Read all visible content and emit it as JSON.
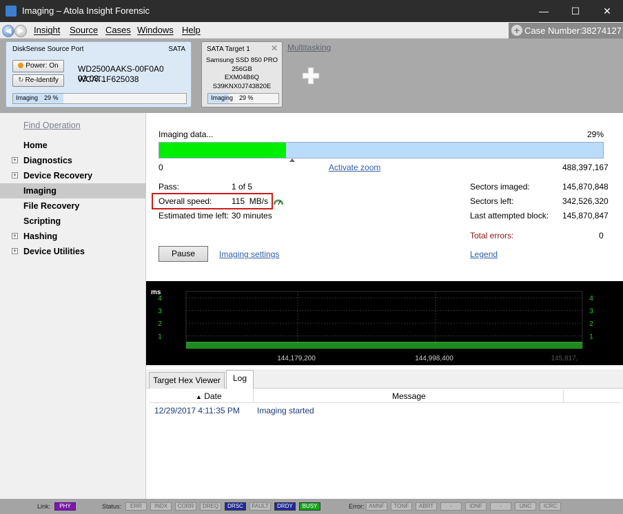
{
  "window": {
    "title": "Imaging – Atola Insight Forensic"
  },
  "menu": [
    "Insight",
    "Source",
    "Cases",
    "Windows",
    "Help"
  ],
  "case": {
    "label": "Case Number:",
    "number": "38274127"
  },
  "source_card": {
    "title": "DiskSense Source Port",
    "iface": "SATA",
    "power_label": "Power: On",
    "reidentify_label": "Re-Identify",
    "model": "WD2500AAKS-00F0A0 03.03...",
    "serial": "WCAT1F625038",
    "status": "Imaging",
    "percent": "29 %",
    "progress": 0.29
  },
  "target_card": {
    "title": "SATA Target 1",
    "line1": "Samsung SSD 850 PRO",
    "line2": "256GB",
    "line3": "EXM04B6Q",
    "line4": "S39KNX0J743820E",
    "status": "Imaging",
    "percent": "29 %",
    "progress": 0.29
  },
  "multitasking": "Multitasking",
  "sidebar": {
    "find": "Find Operation",
    "items": [
      {
        "label": "Home",
        "expandable": false
      },
      {
        "label": "Diagnostics",
        "expandable": true
      },
      {
        "label": "Device Recovery",
        "expandable": true
      },
      {
        "label": "Imaging",
        "expandable": false,
        "selected": true
      },
      {
        "label": "File Recovery",
        "expandable": false
      },
      {
        "label": "Scripting",
        "expandable": false
      },
      {
        "label": "Hashing",
        "expandable": true
      },
      {
        "label": "Device Utilities",
        "expandable": true
      }
    ]
  },
  "imaging": {
    "status": "Imaging data...",
    "percent": "29%",
    "progress": 0.29,
    "range_start": "0",
    "range_end": "488,397,167",
    "zoom_link": "Activate zoom",
    "pass_label": "Pass:",
    "pass_value": "1 of 5",
    "speed_label": "Overall speed:",
    "speed_value": "115  MB/s",
    "eta_label": "Estimated time left:",
    "eta_value": "30 minutes",
    "sectors_imaged_label": "Sectors imaged:",
    "sectors_imaged": "145,870,848",
    "sectors_left_label": "Sectors left:",
    "sectors_left": "342,526,320",
    "last_block_label": "Last attempted block:",
    "last_block": "145,870,847",
    "errors_label": "Total errors:",
    "errors": "0",
    "pause": "Pause",
    "settings_link": "Imaging settings",
    "legend_link": "Legend"
  },
  "chart_data": {
    "type": "area",
    "ylabel": "ms",
    "yticks": [
      "1",
      "2",
      "3",
      "4"
    ],
    "ylim": [
      0,
      4.5
    ],
    "xticks": [
      "144,179,200",
      "144,998,400",
      "145,817,"
    ],
    "baseline_value": 0.5,
    "color": "#1f8a1f",
    "grid": true
  },
  "tabs": [
    "Target Hex Viewer",
    "Log"
  ],
  "active_tab": "Log",
  "log": {
    "columns": [
      "Date",
      "Message"
    ],
    "sort_indicator": "▲",
    "rows": [
      {
        "date": "12/29/2017 4:11:35 PM",
        "message": "Imaging started"
      }
    ]
  },
  "statusbar": {
    "link_label": "Link:",
    "link": "PHY",
    "status_label": "Status:",
    "status_items": [
      {
        "label": "ERR",
        "on": false
      },
      {
        "label": "INDX",
        "on": false
      },
      {
        "label": "CORR",
        "on": false
      },
      {
        "label": "DREQ",
        "on": false
      },
      {
        "label": "DRSC",
        "on": true,
        "color": "#1e2a9a"
      },
      {
        "label": "FAULT",
        "on": false
      },
      {
        "label": "DRDY",
        "on": true,
        "color": "#1e2a9a"
      },
      {
        "label": "BUSY",
        "on": true,
        "color": "#12a61a"
      }
    ],
    "error_label": "Error:",
    "error_items": [
      "AMNF",
      "TONF",
      "ABRT",
      "-",
      "IDNF",
      "-",
      "UNC",
      "ICRC"
    ]
  }
}
